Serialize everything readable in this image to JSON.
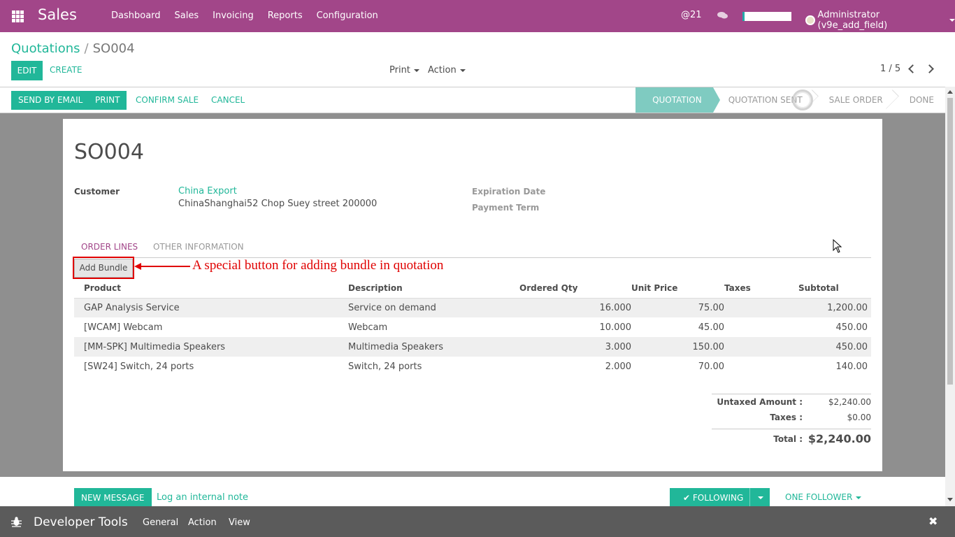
{
  "navbar": {
    "brand": "Sales",
    "menu": [
      "Dashboard",
      "Sales",
      "Invoicing",
      "Reports",
      "Configuration"
    ],
    "mentions": "@21",
    "user": "Administrator (v9e_add_field)"
  },
  "breadcrumb": {
    "parent": "Quotations",
    "separator": "/",
    "current": "SO004"
  },
  "control_panel": {
    "edit_label": "EDIT",
    "create_label": "CREATE",
    "print_label": "Print",
    "action_label": "Action",
    "pager": "1 / 5"
  },
  "header": {
    "send_email_label": "SEND BY EMAIL",
    "print_label": "PRINT",
    "confirm_label": "CONFIRM SALE",
    "cancel_label": "CANCEL",
    "stages": [
      "QUOTATION",
      "QUOTATION SENT",
      "SALE ORDER",
      "DONE"
    ],
    "active_stage": "QUOTATION"
  },
  "form": {
    "title": "SO004",
    "customer_label": "Customer",
    "customer_name": "China Export",
    "customer_address": "ChinaShanghai52 Chop Suey street 200000",
    "expiration_label": "Expiration Date",
    "payment_term_label": "Payment Term"
  },
  "tabs": {
    "order_lines": "ORDER LINES",
    "other_info": "OTHER INFORMATION"
  },
  "bundle": {
    "button_label": "Add Bundle",
    "annotation": "A special button for adding bundle in quotation"
  },
  "order_lines": {
    "headers": [
      "Product",
      "Description",
      "Ordered Qty",
      "Unit Price",
      "Taxes",
      "Subtotal"
    ],
    "rows": [
      {
        "product": "GAP Analysis Service",
        "description": "Service on demand",
        "qty": "16.000",
        "price": "75.00",
        "taxes": "",
        "subtotal": "1,200.00"
      },
      {
        "product": "[WCAM] Webcam",
        "description": "Webcam",
        "qty": "10.000",
        "price": "45.00",
        "taxes": "",
        "subtotal": "450.00"
      },
      {
        "product": "[MM-SPK] Multimedia Speakers",
        "description": "Multimedia Speakers",
        "qty": "3.000",
        "price": "150.00",
        "taxes": "",
        "subtotal": "450.00"
      },
      {
        "product": "[SW24] Switch, 24 ports",
        "description": "Switch, 24 ports",
        "qty": "2.000",
        "price": "70.00",
        "taxes": "",
        "subtotal": "140.00"
      }
    ]
  },
  "totals": {
    "untaxed_label": "Untaxed Amount :",
    "untaxed_value": "$2,240.00",
    "taxes_label": "Taxes :",
    "taxes_value": "$0.00",
    "total_label": "Total :",
    "total_value": "$2,240.00"
  },
  "chatter": {
    "new_message_label": "NEW MESSAGE",
    "log_note_label": "Log an internal note",
    "following_label": "FOLLOWING",
    "followers_label": "ONE FOLLOWER"
  },
  "devtools": {
    "title": "Developer Tools",
    "menu": [
      "General",
      "Action",
      "View"
    ],
    "close": "✖"
  },
  "colors": {
    "brand": "#a24689",
    "primary": "#21b799",
    "annotation": "#e00000"
  }
}
